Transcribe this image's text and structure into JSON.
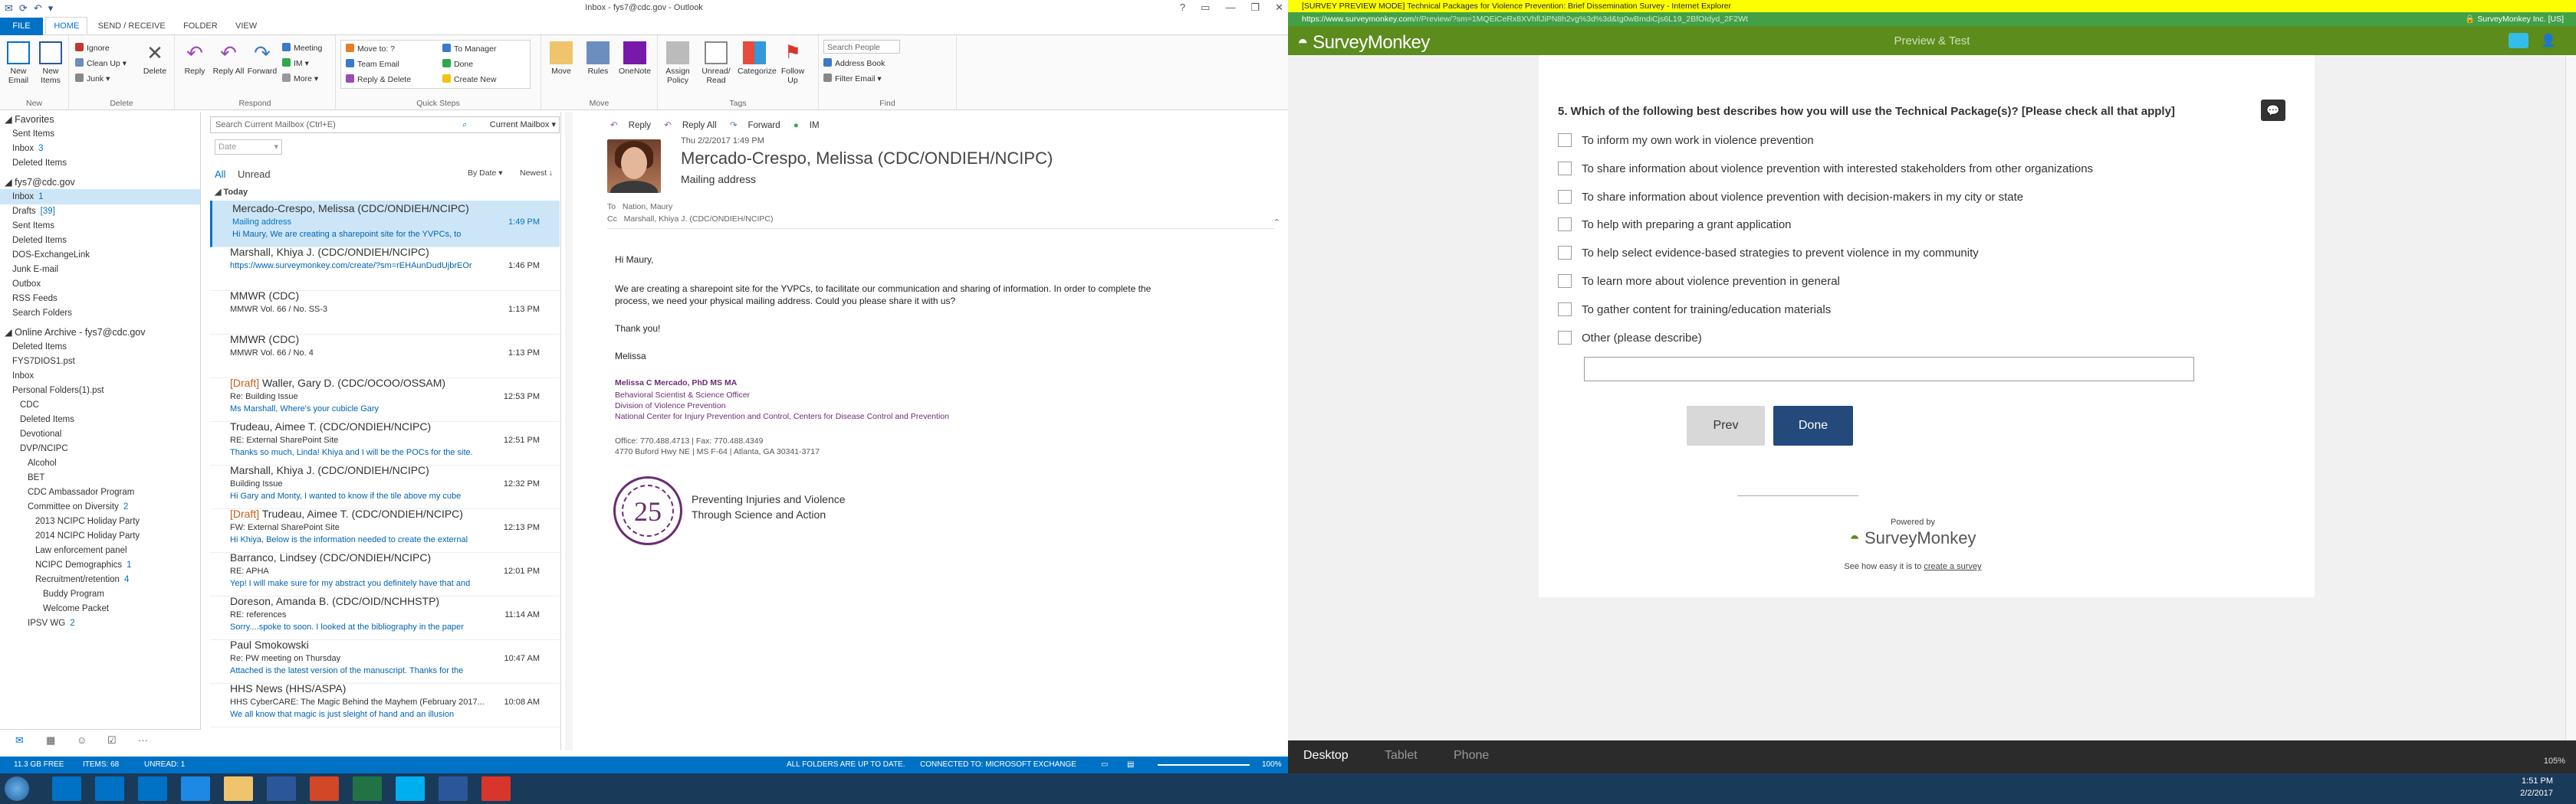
{
  "outlook": {
    "window_title": "Inbox - fys7@cdc.gov - Outlook",
    "tabs": [
      "FILE",
      "HOME",
      "SEND / RECEIVE",
      "FOLDER",
      "VIEW"
    ],
    "active_tab": "HOME",
    "ribbon": {
      "new": {
        "new_email": "New Email",
        "new_items": "New Items",
        "label": "New"
      },
      "delete": {
        "ignore": "Ignore",
        "clean_up": "Clean Up",
        "junk": "Junk",
        "delete": "Delete",
        "label": "Delete"
      },
      "respond": {
        "reply": "Reply",
        "reply_all": "Reply All",
        "forward": "Forward",
        "meeting": "Meeting",
        "im": "IM",
        "more": "More",
        "label": "Respond"
      },
      "quick_steps": {
        "move_to": "Move to: ?",
        "team_email": "Team Email",
        "reply_delete": "Reply & Delete",
        "to_manager": "To Manager",
        "done": "Done",
        "create_new": "Create New",
        "label": "Quick Steps"
      },
      "move": {
        "move": "Move",
        "rules": "Rules",
        "onenote": "OneNote",
        "label": "Move"
      },
      "tags": {
        "assign_policy": "Assign Policy",
        "unread_read": "Unread/ Read",
        "categorize": "Categorize",
        "follow_up": "Follow Up",
        "label": "Tags"
      },
      "find": {
        "search_people": "Search People",
        "address_book": "Address Book",
        "filter_email": "Filter Email",
        "label": "Find"
      }
    },
    "nav": [
      {
        "label": "Favorites",
        "level": 0,
        "type": "header"
      },
      {
        "label": "Sent Items",
        "level": 1
      },
      {
        "label": "Inbox",
        "level": 1,
        "count": "3"
      },
      {
        "label": "Deleted Items",
        "level": 1
      },
      {
        "label": "fys7@cdc.gov",
        "level": 0,
        "type": "header"
      },
      {
        "label": "Inbox",
        "level": 1,
        "count": "1",
        "selected": true
      },
      {
        "label": "Drafts",
        "level": 1,
        "count": "[39]"
      },
      {
        "label": "Sent Items",
        "level": 1
      },
      {
        "label": "Deleted Items",
        "level": 1
      },
      {
        "label": "DOS-ExchangeLink",
        "level": 1
      },
      {
        "label": "Junk E-mail",
        "level": 1
      },
      {
        "label": "Outbox",
        "level": 1
      },
      {
        "label": "RSS Feeds",
        "level": 1
      },
      {
        "label": "Search Folders",
        "level": 1
      },
      {
        "label": "Online Archive - fys7@cdc.gov",
        "level": 0,
        "type": "header"
      },
      {
        "label": "Deleted Items",
        "level": 1
      },
      {
        "label": "FYS7DIOS1.pst",
        "level": 1
      },
      {
        "label": "Inbox",
        "level": 1
      },
      {
        "label": "Personal Folders(1).pst",
        "level": 1
      },
      {
        "label": "CDC",
        "level": 2
      },
      {
        "label": "Deleted Items",
        "level": 2
      },
      {
        "label": "Devotional",
        "level": 2
      },
      {
        "label": "DVP/NCIPC",
        "level": 2
      },
      {
        "label": "Alcohol",
        "level": 3
      },
      {
        "label": "BET",
        "level": 3
      },
      {
        "label": "CDC Ambassador Program",
        "level": 3
      },
      {
        "label": "Committee on Diversity",
        "level": 3,
        "count": "2"
      },
      {
        "label": "2013 NCIPC Holiday Party",
        "level": 4
      },
      {
        "label": "2014 NCIPC Holiday Party",
        "level": 4
      },
      {
        "label": "Law enforcement panel",
        "level": 4
      },
      {
        "label": "NCIPC Demographics",
        "level": 4,
        "count": "1"
      },
      {
        "label": "Recruitment/retention",
        "level": 4,
        "count": "4"
      },
      {
        "label": "Buddy Program",
        "level": 5
      },
      {
        "label": "Welcome Packet",
        "level": 5
      },
      {
        "label": "IPSV WG",
        "level": 3,
        "count": "2"
      }
    ],
    "search": {
      "placeholder": "Search Current Mailbox (Ctrl+E)",
      "scope": "Current Mailbox"
    },
    "date_filter": "Date",
    "filters": {
      "all": "All",
      "unread": "Unread",
      "by_date": "By Date",
      "newest": "Newest"
    },
    "group_today": "Today",
    "messages": [
      {
        "from": "Mercado-Crespo, Melissa (CDC/ONDIEH/NCIPC)",
        "subject": "Mailing address",
        "preview": "Hi Maury,  We are creating a sharepoint site for the YVPCs, to",
        "time": "1:49 PM",
        "selected": true
      },
      {
        "from": "Marshall, Khiya J. (CDC/ONDIEH/NCIPC)",
        "subject": "",
        "preview": "https://www.surveymonkey.com/create/?sm=rEHAunDudUjbrEOr",
        "time": "1:46 PM"
      },
      {
        "from": "MMWR (CDC)",
        "subject": "MMWR Vol. 66 / No. SS-3",
        "preview": "",
        "time": "1:13 PM"
      },
      {
        "from": "MMWR (CDC)",
        "subject": "MMWR Vol. 66 / No. 4",
        "preview": "",
        "time": "1:13 PM"
      },
      {
        "draft": "[Draft]",
        "from": "Waller, Gary D. (CDC/OCOO/OSSAM)",
        "subject": "Re: Building Issue",
        "preview": "Ms Marshall,   Where's your cubicle   Gary",
        "time": "12:53 PM"
      },
      {
        "from": "Trudeau, Aimee T. (CDC/ONDIEH/NCIPC)",
        "subject": "RE: External SharePoint Site",
        "preview": "Thanks so much, Linda! Khiya and I will be the POCs for the site.",
        "time": "12:51 PM"
      },
      {
        "from": "Marshall, Khiya J. (CDC/ONDIEH/NCIPC)",
        "subject": "Building Issue",
        "preview": "Hi Gary and Monty,  I wanted to know if the tile above my cube",
        "time": "12:32 PM"
      },
      {
        "draft": "[Draft]",
        "from": "Trudeau, Aimee T. (CDC/ONDIEH/NCIPC)",
        "subject": "FW: External SharePoint Site",
        "preview": "Hi Khiya,  Below is the information needed to create the external",
        "time": "12:13 PM"
      },
      {
        "from": "Barranco, Lindsey (CDC/ONDIEH/NCIPC)",
        "subject": "RE: APHA",
        "preview": "Yep! I will make sure for my abstract you definitely have that and",
        "time": "12:01 PM"
      },
      {
        "from": "Doreson, Amanda B. (CDC/OID/NCHHSTP)",
        "subject": "RE: references",
        "preview": "Sorry....spoke to soon. I looked at the bibliography in the paper",
        "time": "11:14 AM"
      },
      {
        "from": "Paul Smokowski",
        "subject": "Re: PW meeting on Thursday",
        "preview": "Attached is the latest version of the manuscript.  Thanks for the",
        "time": "10:47 AM"
      },
      {
        "from": "HHS News (HHS/ASPA)",
        "subject": "HHS CyberCARE: The Magic Behind the Mayhem (February 2017...",
        "preview": "We all know that magic is just sleight of hand and an illusion",
        "time": "10:08 AM"
      }
    ],
    "reading": {
      "actions": [
        "Reply",
        "Reply All",
        "Forward",
        "IM"
      ],
      "date": "Thu 2/2/2017 1:49 PM",
      "from": "Mercado-Crespo, Melissa (CDC/ONDIEH/NCIPC)",
      "subject": "Mailing address",
      "to_label": "To",
      "to": "Nation, Maury",
      "cc_label": "Cc",
      "cc": "Marshall, Khiya J. (CDC/ONDIEH/NCIPC)",
      "greeting": "Hi Maury,",
      "body1": "We are creating a sharepoint site for the YVPCs, to facilitate our communication and sharing of information.  In order to complete the",
      "body2": "process, we need your physical mailing address. Could you please share it with us?",
      "thanks": "Thank you!",
      "sender_first": "Melissa",
      "sig_name": "Melissa C Mercado, PhD MS MA",
      "sig_title": "Behavioral Scientist & Science Officer",
      "sig_division": "Division of Violence Prevention",
      "sig_center": "National Center for Injury Prevention and Control, Centers for Disease Control and Prevention",
      "sig_office": "Office: 770.488.4713  |  Fax: 770.488.4349",
      "sig_address": "4770 Buford Hwy NE  |  MS F-64  |  Atlanta, GA 30341-3717",
      "seal_number": "25",
      "seal_line1": "Preventing Injuries and Violence",
      "seal_line2": "Through Science and Action"
    },
    "status": {
      "storage": "11.3 GB FREE",
      "items": "ITEMS: 68",
      "unread": "UNREAD: 1",
      "folders": "ALL FOLDERS ARE UP TO DATE.",
      "connected": "CONNECTED TO: MICROSOFT EXCHANGE",
      "zoom": "100%"
    }
  },
  "browser": {
    "title": "[SURVEY PREVIEW MODE] Technical Packages for Violence Prevention: Brief Dissemination Survey - Internet Explorer",
    "address_host": "https://www.surveymonkey.com",
    "address_path": "/r/Preview/?sm=1MQEiCeRx8XVhflJiPN8h2vg%3d%3d&tg0wBmdiCjs6L19_2BfOIdyd_2F2Wt",
    "lock_text": "SurveyMonkey Inc. [US]",
    "brand": "SurveyMonkey",
    "preview_label": "Preview & Test",
    "question": "5. Which of the following best describes how you will use the Technical Package(s)? [Please check all that apply]",
    "options": [
      "To inform my own work in violence prevention",
      "To share information about violence prevention with interested stakeholders from other organizations",
      "To share information about violence prevention with decision-makers in my city or state",
      "To help with preparing a grant application",
      "To help select evidence-based strategies to prevent violence in my community",
      "To learn more about violence prevention in general",
      "To gather content for training/education materials",
      "Other (please describe)"
    ],
    "prev": "Prev",
    "done": "Done",
    "powered_by": "Powered by",
    "see_how": "See how easy it is to",
    "create_link": "create a survey",
    "view_modes": [
      "Desktop",
      "Tablet",
      "Phone"
    ],
    "active_view": "Desktop",
    "zoom": "105%"
  },
  "taskbar": {
    "time": "1:51 PM",
    "date": "2/2/2017"
  },
  "colors": {
    "outlook_blue": "#0072c6",
    "sm_green": "#5b8c1c",
    "sm_dark": "#234a7a",
    "preview_yellow": "#ffff00"
  }
}
